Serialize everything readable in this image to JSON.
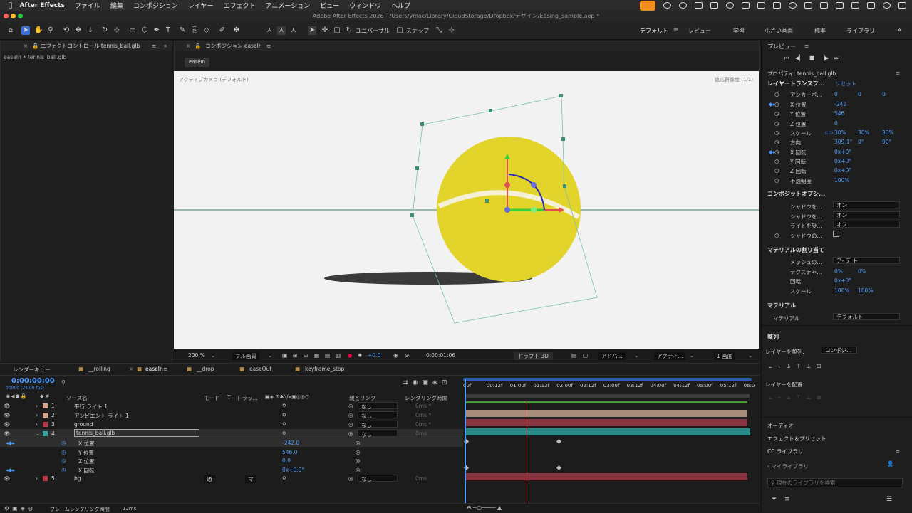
{
  "menubar": {
    "app": "After Effects",
    "items": [
      "ファイル",
      "編集",
      "コンポジション",
      "レイヤー",
      "エフェクト",
      "アニメーション",
      "ビュー",
      "ウィンドウ",
      "ヘルプ"
    ]
  },
  "titlebar": {
    "title": "Adobe After Effects 2026 - /Users/ymac/Library/CloudStorage/Dropbox/デザイン/Easing_sample.aep *"
  },
  "toolbar": {
    "universal": "ユニバーサル",
    "snap": "スナップ",
    "workspaces": [
      "デフォルト",
      "レビュー",
      "学習",
      "小さい画面",
      "標準",
      "ライブラリ"
    ]
  },
  "effect_panel": {
    "tab": "エフェクトコントロール tennis_ball.glb",
    "breadcrumb": "easeIn • tennis_ball.glb"
  },
  "comp_panel": {
    "tab": "コンポジション easeIn",
    "subtab": "easeIn",
    "camera": "アクティブカメラ (デフォルト)",
    "renderer": "追応群像度 (1/1)"
  },
  "viewer_bottom": {
    "zoom": "200 %",
    "quality": "フル画質",
    "exposure": "+0.0",
    "timecode": "0:00:01:06",
    "draft": "ドラフト 3D",
    "renderer": "アドバ...",
    "camera": "アクティ...",
    "views": "1 画面"
  },
  "preview": {
    "title": "プレビュー"
  },
  "properties": {
    "title": "プロパティ: tennis_ball.glb",
    "layer_transform": "レイヤートランスフ...",
    "reset": "リセット",
    "rows": [
      {
        "label": "アンカーポ...",
        "values": [
          "0",
          "0",
          "0"
        ]
      },
      {
        "label": "X 位置",
        "values": [
          "-242"
        ]
      },
      {
        "label": "Y 位置",
        "values": [
          "546"
        ]
      },
      {
        "label": "Z 位置",
        "values": [
          "0"
        ]
      },
      {
        "label": "スケール",
        "values": [
          "30%",
          "30%",
          "30%"
        ]
      },
      {
        "label": "方向",
        "values": [
          "309.1°",
          "0°",
          "90°"
        ]
      },
      {
        "label": "X 回転",
        "values": [
          "0x+0°"
        ]
      },
      {
        "label": "Y 回転",
        "values": [
          "0x+0°"
        ]
      },
      {
        "label": "Z 回転",
        "values": [
          "0x+0°"
        ]
      },
      {
        "label": "不透明度",
        "values": [
          "100%"
        ]
      }
    ],
    "composite_title": "コンポジットオプシ...",
    "composite": [
      {
        "label": "シャドウを...",
        "value": "オン"
      },
      {
        "label": "シャドウを...",
        "value": "オン"
      },
      {
        "label": "ライトを受...",
        "value": "オフ"
      },
      {
        "label": "シャドウの..."
      }
    ],
    "material_wrap_title": "マテリアルの割り当て",
    "material_wrap": [
      {
        "label": "メッシュの...",
        "value": "ア- テ ト"
      },
      {
        "label": "テクスチャ...",
        "values": [
          "0%",
          "0%"
        ]
      },
      {
        "label": "回転",
        "values": [
          "0x+0°"
        ]
      },
      {
        "label": "スケール",
        "values": [
          "100%",
          "100%"
        ]
      }
    ],
    "material_title": "マテリアル",
    "material_label": "マテリアル",
    "material_value": "デフォルト",
    "align_title": "整列",
    "align_layers": "レイヤーを整列:",
    "align_target": "コンポジ...",
    "distribute": "レイヤーを配置:",
    "audio": "オーディオ",
    "effects": "エフェクト＆プリセット",
    "cc": "CC ライブラリ",
    "mylib": "マイライブラリ",
    "search_placeholder": "現在のライブラリを検索"
  },
  "timeline": {
    "tabs": [
      "レンダーキュー",
      "__rolling",
      "easeIn",
      "__drop",
      "easeOut",
      "keyframe_stop"
    ],
    "timecode": "0:00:00:00",
    "fps": "00000 (24.00 fps)",
    "headers": {
      "source": "ソース名",
      "mode": "モード",
      "t": "T",
      "track": "トラッ...",
      "parent": "親とリンク",
      "render": "レンダリング時間"
    },
    "ruler": [
      "00f",
      "00:12f",
      "01:00f",
      "01:12f",
      "02:00f",
      "02:12f",
      "03:00f",
      "03:12f",
      "04:00f",
      "04:12f",
      "05:00f",
      "05:12f",
      "06:0"
    ],
    "layers": [
      {
        "num": "1",
        "name": "平行 ライト 1",
        "parent": "なし",
        "render": "0ms *"
      },
      {
        "num": "2",
        "name": "アンビエント ライト 1",
        "parent": "なし",
        "render": "0ms *"
      },
      {
        "num": "3",
        "name": "ground",
        "parent": "なし",
        "render": "0ms *"
      },
      {
        "num": "4",
        "name": "tennis_ball.glb",
        "parent": "なし",
        "render": "0ms"
      },
      {
        "num": "5",
        "name": "bg",
        "parent": "なし",
        "render": "0ms"
      }
    ],
    "props": [
      {
        "name": "X 位置",
        "value": "-242.0"
      },
      {
        "name": "Y 位置",
        "value": "546.0"
      },
      {
        "name": "Z 位置",
        "value": "0.0"
      },
      {
        "name": "X 回転",
        "value": "0x+0.0°"
      }
    ],
    "bg_mode": "通",
    "bg_track": "マ",
    "status": "フレームレンダリング時間",
    "status_ms": "12ms"
  },
  "colors": {
    "accent": "#4d9cff",
    "ball": "#e2d42b",
    "bar_lights": "#a88c7c",
    "bar_ground": "#8a3441",
    "bar_ball": "#2a8a8a"
  }
}
